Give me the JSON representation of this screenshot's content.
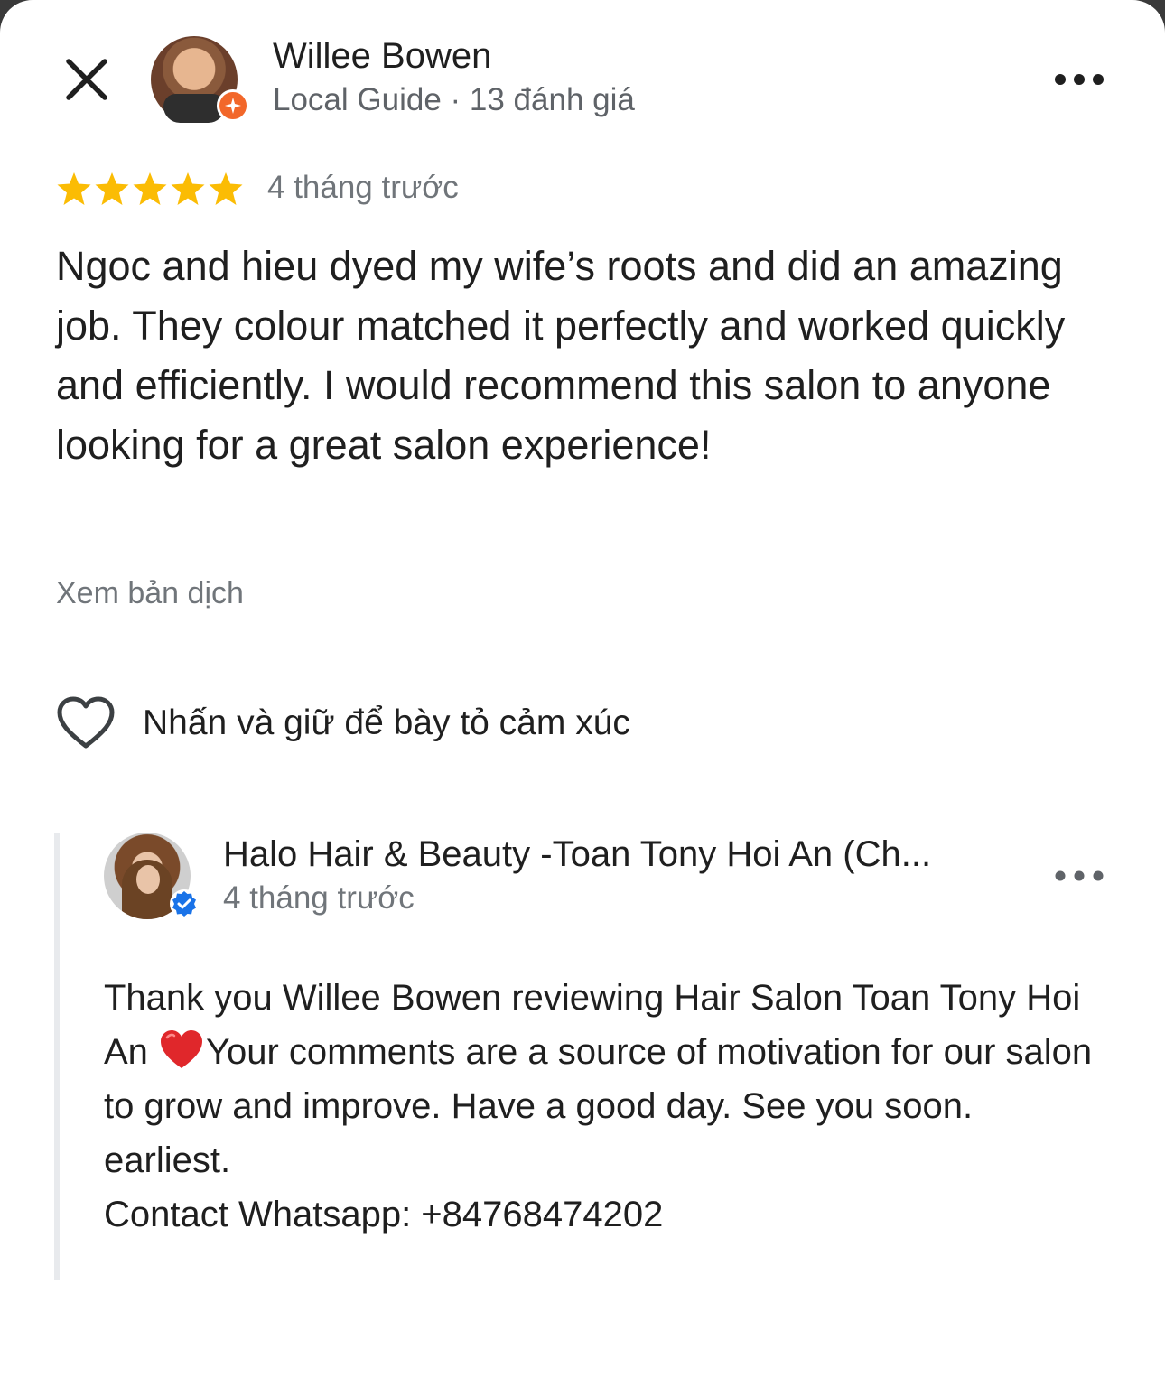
{
  "reviewer": {
    "name": "Willee Bowen",
    "meta": "Local Guide · 13 đánh giá"
  },
  "review": {
    "rating": 5,
    "max_rating": 5,
    "time": "4 tháng trước",
    "text": "Ngoc and hieu dyed my wife’s roots and did an amazing job.  They colour matched it perfectly and worked quickly and efficiently.  I would recommend this salon to anyone looking for a great salon experience!",
    "translate_label": "Xem bản dịch"
  },
  "reaction": {
    "label": "Nhấn và giữ để bày tỏ cảm xúc"
  },
  "owner_reply": {
    "name": "Halo Hair & Beauty -Toan Tony Hoi An (Ch...",
    "time": "4 tháng trước",
    "text_part1": "Thank you Willee Bowen reviewing Hair Salon Toan Tony Hoi An",
    "text_part2": "Your comments are a source of motivation for our salon to grow and improve. Have a good day. See you soon. earliest.",
    "contact": "Contact Whatsapp: +84768474202"
  },
  "colors": {
    "star": "#fbbc04",
    "guide_badge": "#f2672a",
    "verified": "#1a73e8",
    "secondary_text": "#70757a"
  },
  "icons": [
    "close-icon",
    "more-icon",
    "star-icon",
    "heart-outline-icon",
    "verified-icon",
    "local-guide-badge-icon",
    "red-heart-emoji"
  ]
}
